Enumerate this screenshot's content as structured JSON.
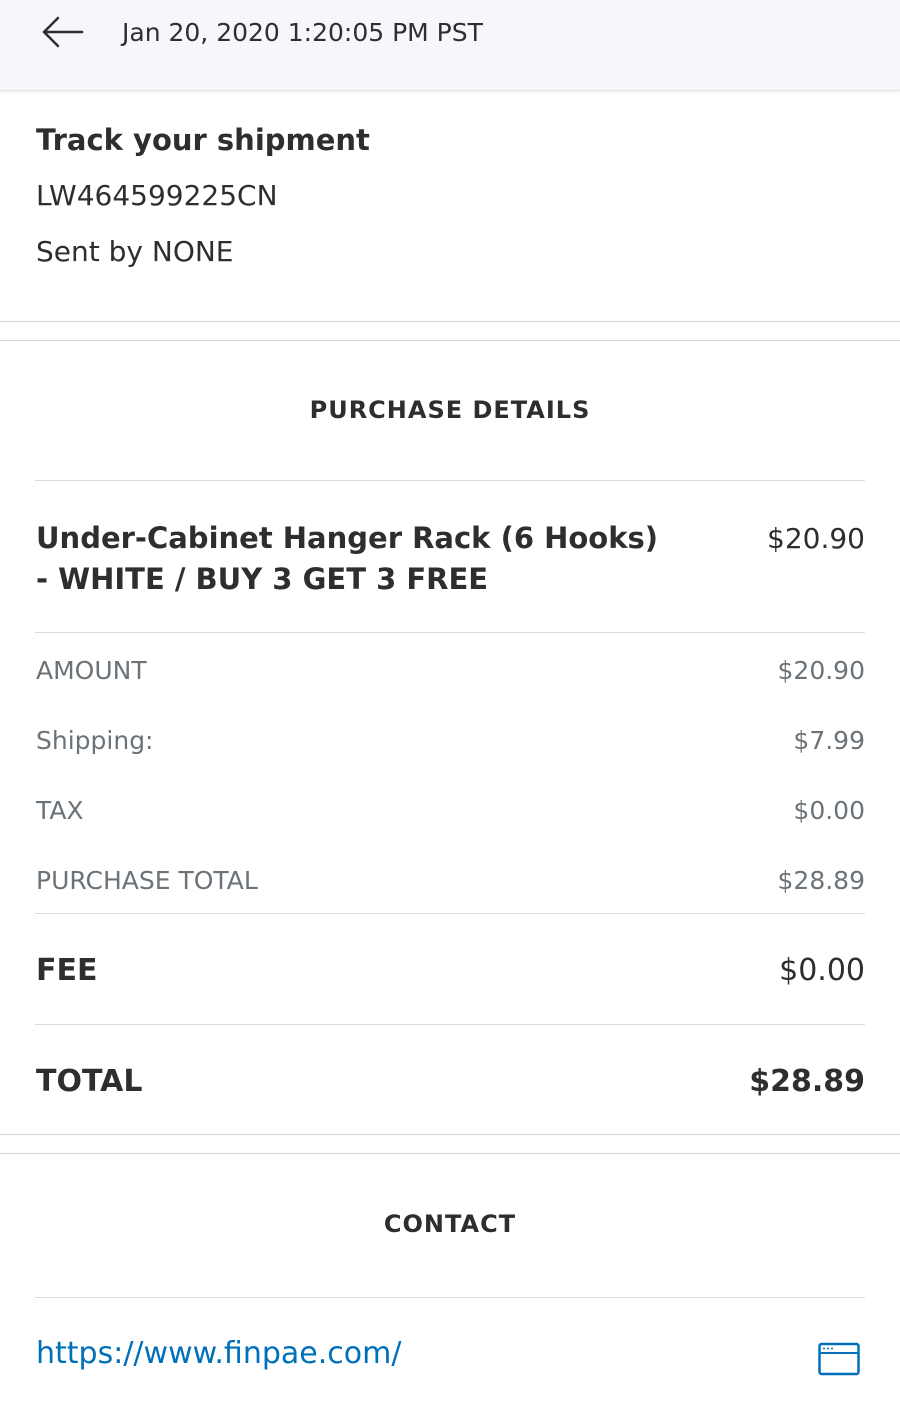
{
  "header": {
    "back_icon": "arrow-left-icon",
    "date": "Jan 20, 2020 1:20:05 PM PST"
  },
  "tracking": {
    "title": "Track your shipment",
    "number": "LW464599225CN",
    "sender": "Sent by NONE"
  },
  "purchase": {
    "heading": "PURCHASE DETAILS",
    "item": {
      "name": "Under-Cabinet Hanger Rack (6 Hooks) - WHITE / BUY 3 GET 3 FREE",
      "price": "$20.90"
    },
    "rows": [
      {
        "label": "AMOUNT",
        "value": "$20.90"
      },
      {
        "label": "Shipping:",
        "value": "$7.99"
      },
      {
        "label": "TAX",
        "value": "$0.00"
      },
      {
        "label": "PURCHASE TOTAL",
        "value": "$28.89"
      }
    ],
    "fee": {
      "label": "FEE",
      "value": "$0.00"
    },
    "total": {
      "label": "TOTAL",
      "value": "$28.89"
    }
  },
  "contact": {
    "heading": "CONTACT",
    "url": "https://www.finpae.com/",
    "url_icon": "browser-window-icon"
  },
  "colors": {
    "link": "#0070ba",
    "topbar_bg": "#f5f7fa",
    "text": "#2c2e2f",
    "muted": "#6c7378"
  }
}
